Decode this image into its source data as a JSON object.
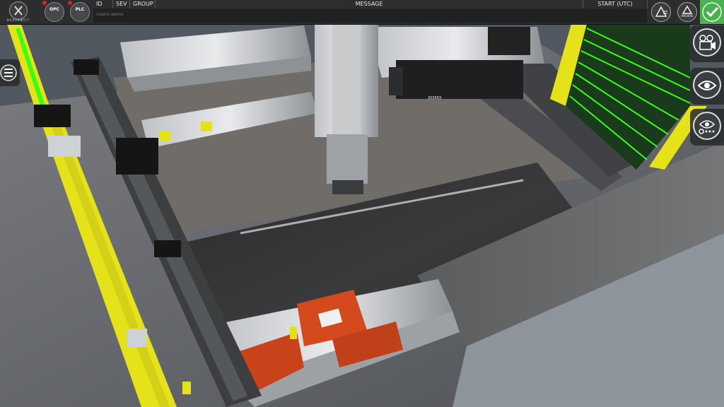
{
  "app": {
    "brand": "NEXASWIFT"
  },
  "connections": [
    {
      "label": "OPC",
      "status_color": "#e02020"
    },
    {
      "label": "PLC",
      "status_color": "#e02020"
    }
  ],
  "alarm_table": {
    "columns": [
      "ID",
      "SEV",
      "GROUP",
      "MESSAGE",
      "START (UTC)"
    ],
    "filter_placeholder": "Search alarms"
  },
  "toolbar": {
    "acknowledge_all_icon": "alarm-ack-icon",
    "archive_label": "ARCHIVE",
    "confirm_icon": "checkmark-icon"
  },
  "side_buttons": [
    {
      "icon": "camera-film-icon"
    },
    {
      "icon": "eye-icon"
    },
    {
      "icon": "eye-settings-icon"
    }
  ],
  "scene_tags": {
    "sensor_tag": "203563"
  },
  "colors": {
    "accent_green": "#4caf50",
    "safety_yellow": "#e6e21a",
    "alarm_red": "#e02020"
  }
}
